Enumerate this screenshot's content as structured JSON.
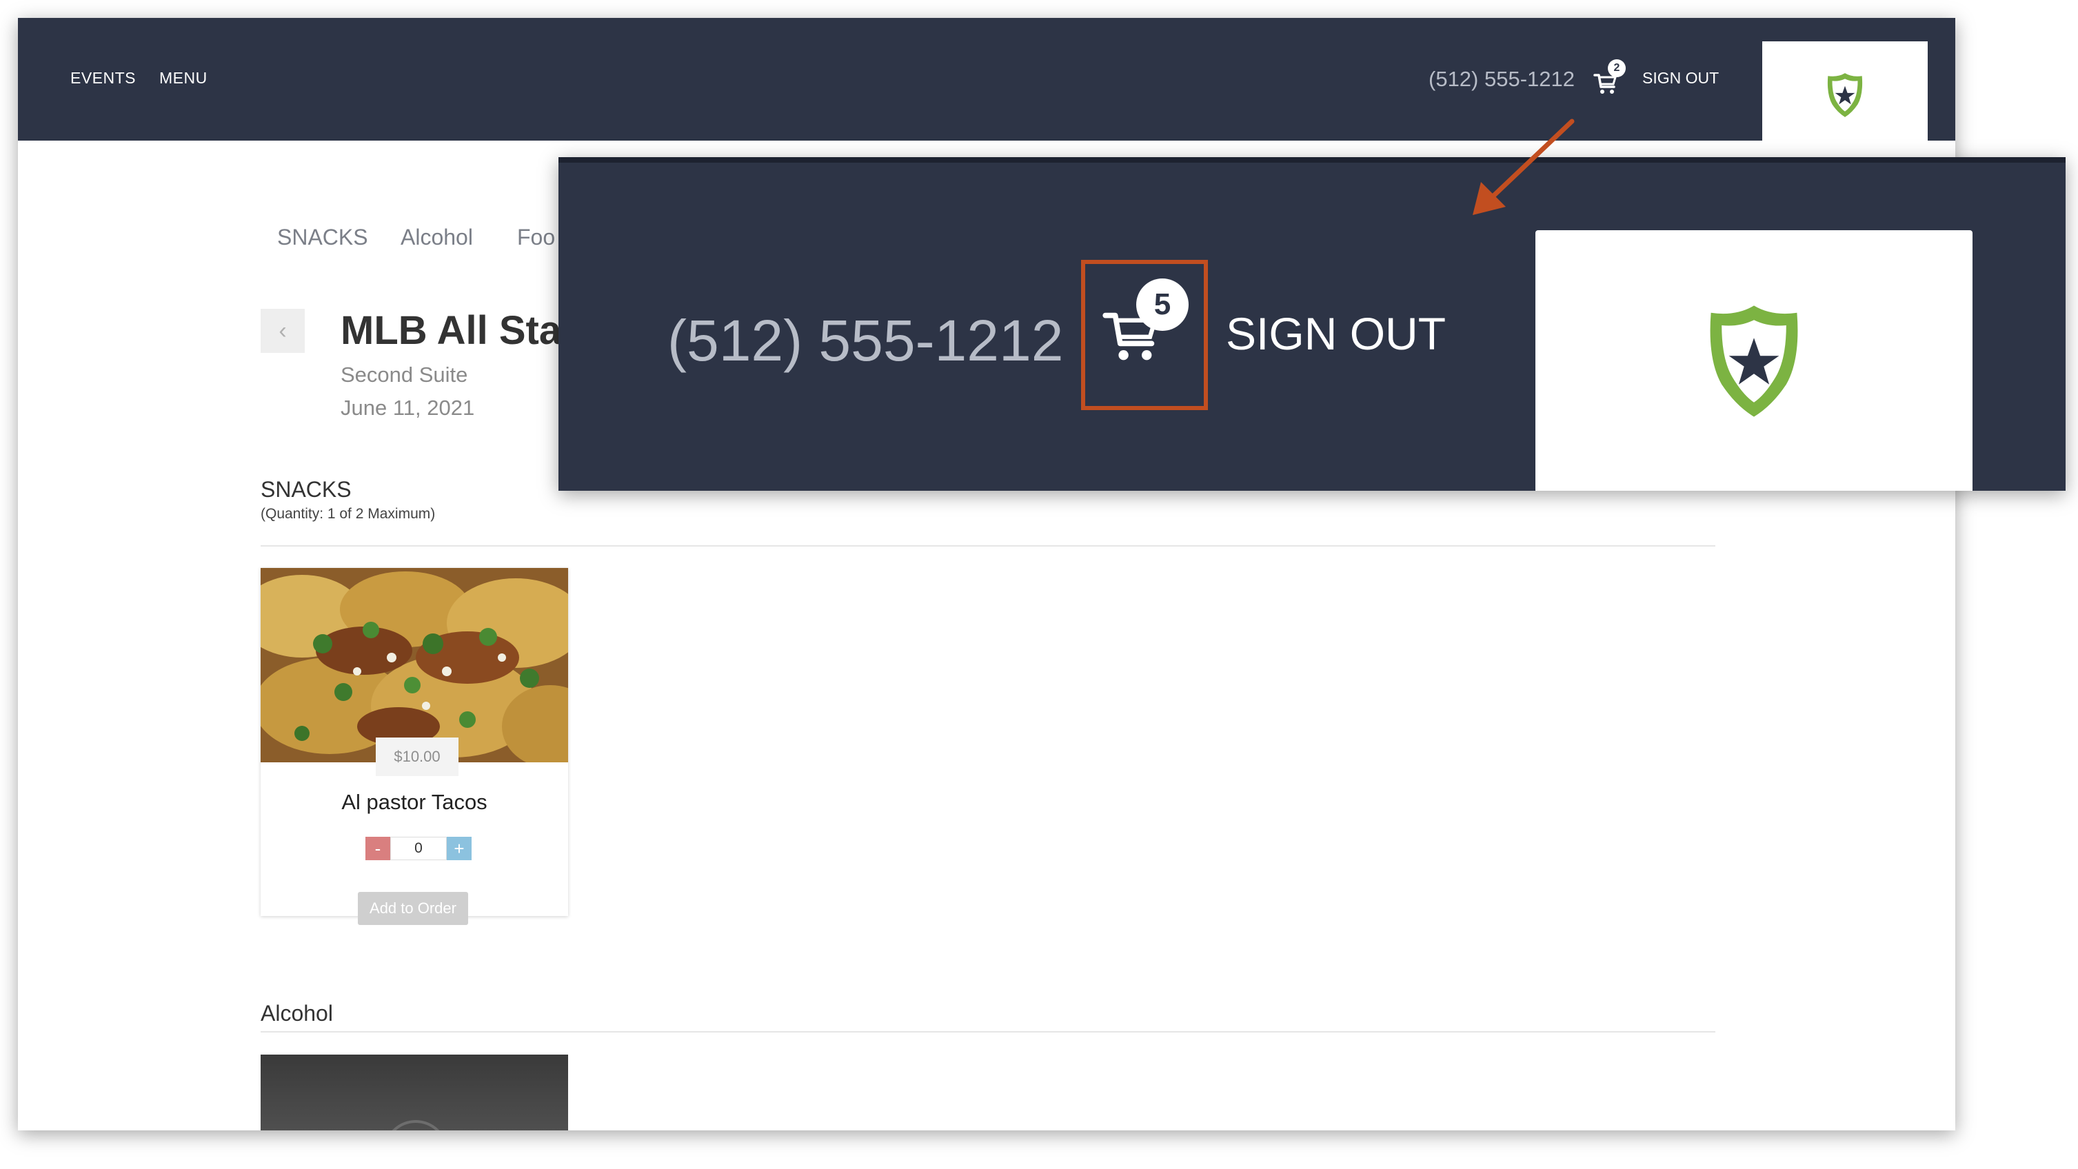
{
  "nav": {
    "events": "EVENTS",
    "menu": "MENU"
  },
  "header": {
    "phone": "(512) 555-1212",
    "cart_count": "2",
    "sign_out": "SIGN OUT"
  },
  "category_tabs": [
    "SNACKS",
    "Alcohol",
    "Foo"
  ],
  "event": {
    "title": "MLB All Star",
    "suite": "Second Suite",
    "date": "June 11, 2021"
  },
  "sections": [
    {
      "title": "SNACKS",
      "quantity_note": "(Quantity: 1 of 2 Maximum)",
      "items": [
        {
          "price": "$10.00",
          "name": "Al pastor Tacos",
          "minus": "-",
          "quantity": "0",
          "plus": "+",
          "add_label": "Add to Order"
        }
      ]
    },
    {
      "title": "Alcohol"
    }
  ],
  "zoom_callout": {
    "phone": "(512) 555-1212",
    "cart_count": "5",
    "sign_out": "SIGN OUT",
    "highlight_color": "#c24e20"
  },
  "colors": {
    "header_bg": "#2d3446",
    "logo_green": "#7cb342",
    "minus_button": "#d97f7f",
    "plus_button": "#8cc2df",
    "arrow": "#c24e20"
  },
  "icons": {
    "cart": "cart-icon",
    "logo": "shield-star-logo",
    "back": "chevron-left-icon",
    "arrow": "callout-arrow"
  }
}
